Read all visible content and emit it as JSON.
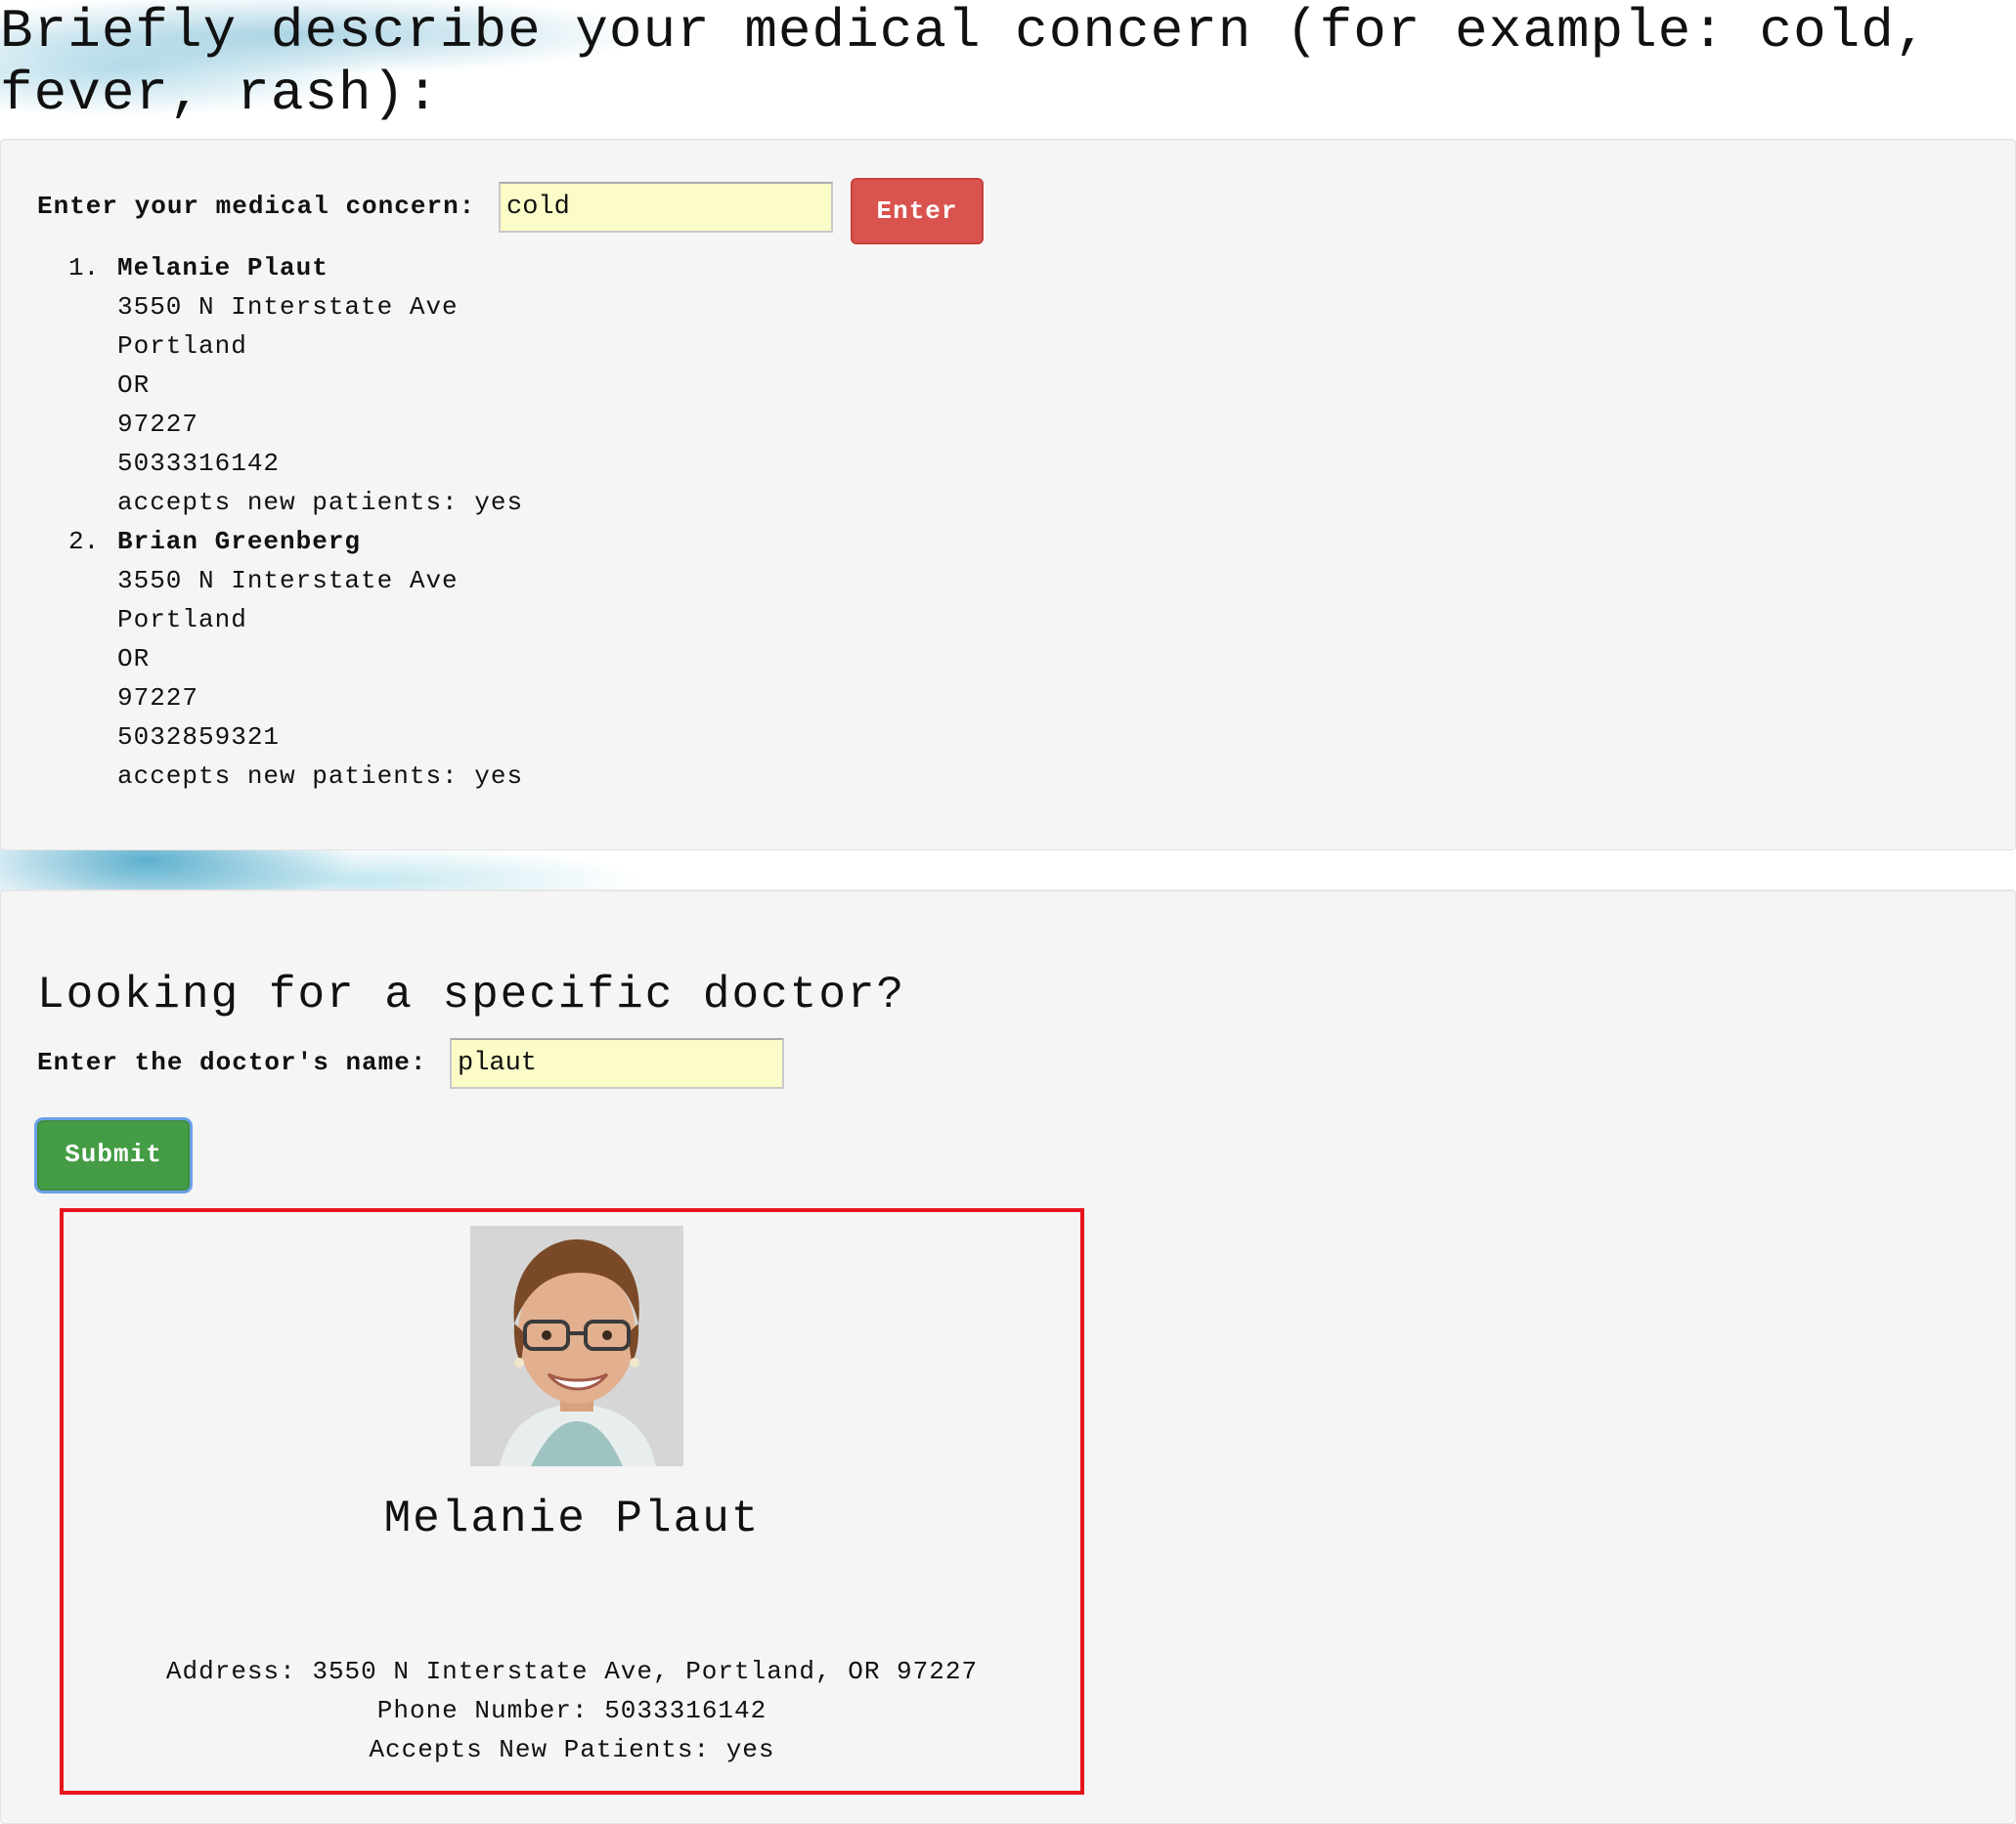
{
  "header": {
    "title": "Briefly describe your medical concern (for example: cold, fever, rash):"
  },
  "concern_search": {
    "label": "Enter your medical concern:",
    "value": "cold",
    "button_label": "Enter"
  },
  "results": [
    {
      "number": "1.",
      "name": "Melanie Plaut",
      "street": "3550 N Interstate Ave",
      "city": "Portland",
      "state": "OR",
      "zip": "97227",
      "phone": "5033316142",
      "accepts": "accepts new patients: yes"
    },
    {
      "number": "2.",
      "name": "Brian Greenberg",
      "street": "3550 N Interstate Ave",
      "city": "Portland",
      "state": "OR",
      "zip": "97227",
      "phone": "5032859321",
      "accepts": "accepts new patients: yes"
    }
  ],
  "doctor_search": {
    "title": "Looking for a specific doctor?",
    "label": "Enter the doctor's name:",
    "value": "plaut",
    "button_label": "Submit"
  },
  "doctor_card": {
    "name": "Melanie Plaut",
    "address": "Address: 3550 N Interstate Ave, Portland, OR 97227",
    "phone": "Phone Number: 5033316142",
    "accepts": "Accepts New Patients: yes",
    "border_color": "#e8141d"
  },
  "colors": {
    "enter_button": "#d9534f",
    "submit_button": "#449d44",
    "input_background": "#fbfcc7"
  }
}
